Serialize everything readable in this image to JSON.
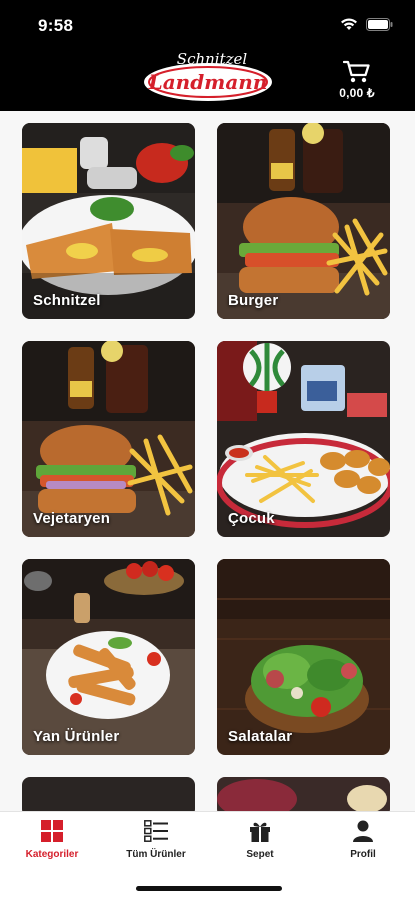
{
  "status_bar": {
    "time": "9:58"
  },
  "header": {
    "logo_top": "Schnitzel",
    "logo_main": "Landmann",
    "cart_total": "0,00 ₺"
  },
  "categories": [
    {
      "label": "Schnitzel",
      "image": "schnitzel-photo"
    },
    {
      "label": "Burger",
      "image": "burger-photo"
    },
    {
      "label": "Vejetaryen",
      "image": "veggie-burger-photo"
    },
    {
      "label": "Çocuk",
      "image": "kids-menu-photo"
    },
    {
      "label": "Yan Ürünler",
      "image": "side-dish-photo"
    },
    {
      "label": "Salatalar",
      "image": "salad-photo"
    }
  ],
  "tabbar": {
    "items": [
      {
        "label": "Kategoriler",
        "icon": "grid-icon",
        "active": true
      },
      {
        "label": "Tüm Ürünler",
        "icon": "list-icon",
        "active": false
      },
      {
        "label": "Sepet",
        "icon": "gift-box-icon",
        "active": false
      },
      {
        "label": "Profil",
        "icon": "person-icon",
        "active": false
      }
    ]
  },
  "colors": {
    "accent": "#d51f2b",
    "header_bg": "#000000",
    "content_bg": "#f7f7f7"
  }
}
